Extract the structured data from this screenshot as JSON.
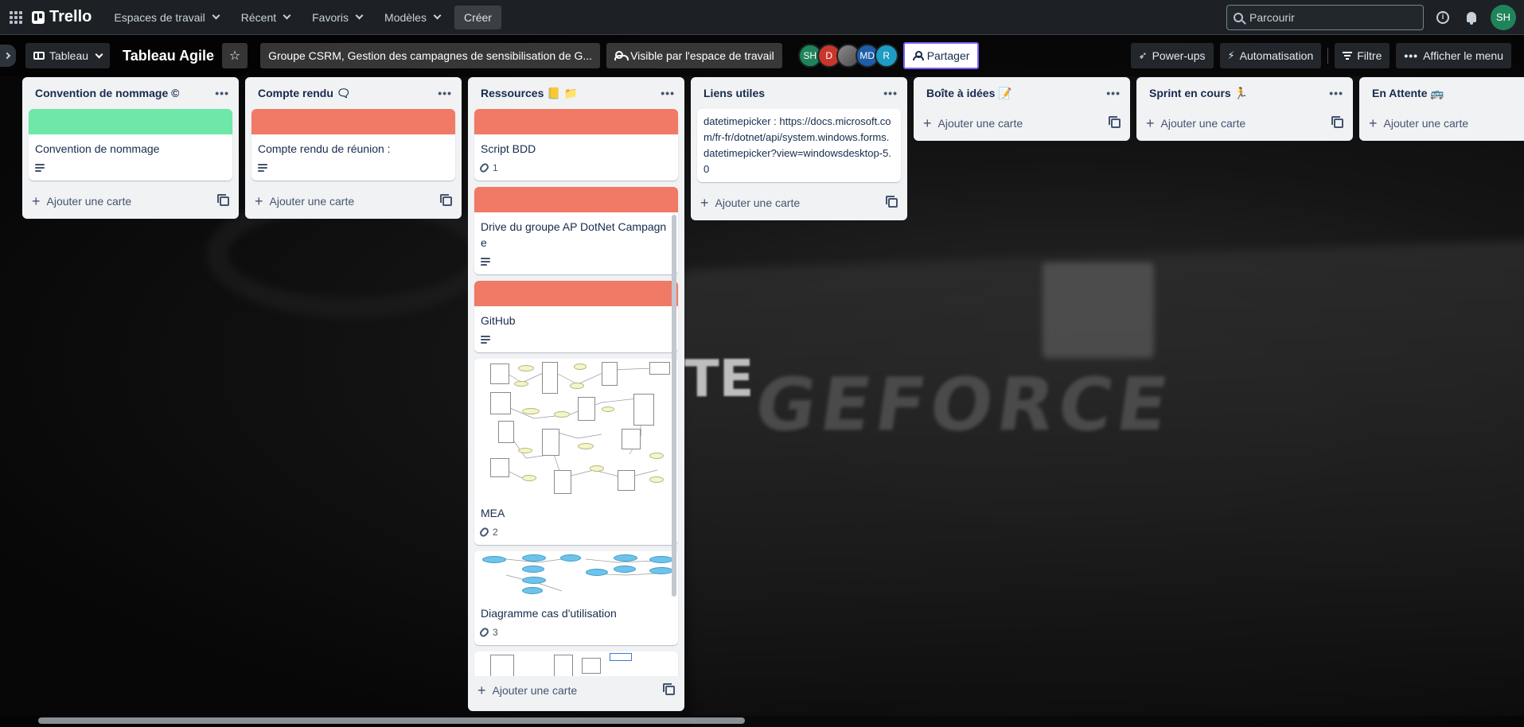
{
  "topbar": {
    "brand": "Trello",
    "nav": [
      "Espaces de travail",
      "Récent",
      "Favoris",
      "Modèles"
    ],
    "create_label": "Créer",
    "search_placeholder": "Parcourir",
    "avatar_initials": "SH"
  },
  "board": {
    "view_label": "Tableau",
    "title": "Tableau Agile",
    "workspace_label": "Groupe CSRM, Gestion des campagnes de sensibilisation de G...",
    "visibility_label": "Visible par l'espace de travail",
    "members": [
      {
        "initials": "SH",
        "color": "#1f845a"
      },
      {
        "initials": "D",
        "color": "#c9372c"
      },
      {
        "initials": "",
        "color": "#6b6b6b"
      },
      {
        "initials": "MD",
        "color": "#1d5ea8"
      },
      {
        "initials": "R",
        "color": "#1d9cc4"
      }
    ],
    "share_label": "Partager",
    "powerups_label": "Power-ups",
    "automation_label": "Automatisation",
    "filter_label": "Filtre",
    "menu_label": "Afficher le menu"
  },
  "add_card_label": "Ajouter une carte",
  "lists": [
    {
      "title": "Convention de nommage ©",
      "cards": [
        {
          "title": "Convention de nommage",
          "cover": "#6ee7a8",
          "has_description": true
        }
      ]
    },
    {
      "title": "Compte rendu 🗨",
      "cards": [
        {
          "title": "Compte rendu de réunion :",
          "cover": "#f07a66",
          "has_description": true
        }
      ]
    },
    {
      "title": "Ressources 📒 📁",
      "cards": [
        {
          "title": "Script BDD",
          "cover": "#f07a66",
          "attachments": "1"
        },
        {
          "title": "Drive du groupe AP DotNet Campagne",
          "cover": "#f07a66",
          "has_description": true
        },
        {
          "title": "GitHub",
          "cover": "#f07a66",
          "has_description": true
        },
        {
          "title": "MEA",
          "cover_image": "er-diagram",
          "attachments": "2"
        },
        {
          "title": "Diagramme cas d'utilisation",
          "cover_image": "use-case-diagram",
          "attachments": "3"
        }
      ]
    },
    {
      "title": "Liens utiles",
      "cards": [
        {
          "title": "datetimepicker : https://docs.microsoft.com/fr-fr/dotnet/api/system.windows.forms.datetimepicker?view=windowsdesktop-5.0"
        }
      ]
    },
    {
      "title": "Boîte à idées 📝",
      "cards": []
    },
    {
      "title": "Sprint en cours 🏃",
      "cards": []
    },
    {
      "title": "En Attente 🚌",
      "cards": []
    }
  ],
  "colors": {
    "topbar_bg": "#1d2125",
    "list_bg": "#f1f2f4",
    "cover_green": "#6ee7a8",
    "cover_red": "#f07a66",
    "share_border": "#7f5fff"
  }
}
